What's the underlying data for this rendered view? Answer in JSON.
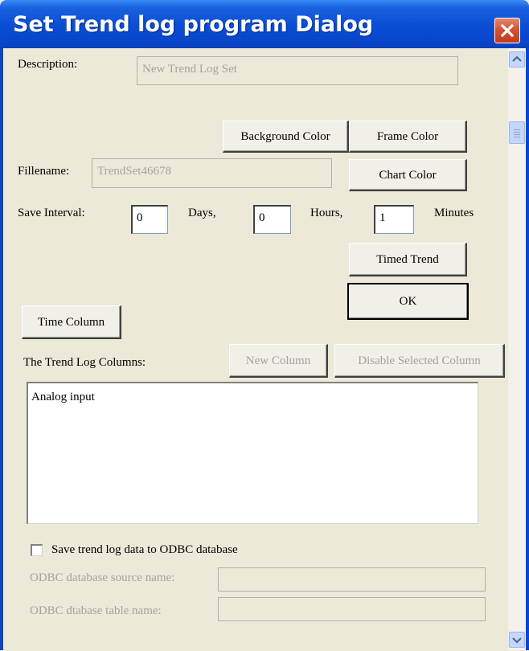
{
  "window": {
    "title": "Set Trend  log program Dialog"
  },
  "description": {
    "label": "Description:",
    "value": "New Trend Log Set"
  },
  "filename": {
    "label": "Fillename:",
    "value": "TrendSet46678"
  },
  "buttons": {
    "background_color": "Background Color",
    "frame_color": "Frame Color",
    "chart_color": "Chart Color",
    "timed_trend": "Timed Trend",
    "ok": "OK",
    "time_column": "Time Column",
    "new_column": "New Column",
    "disable_selected_column": "Disable Selected Column"
  },
  "save_interval": {
    "label": "Save Interval:",
    "days_value": "0",
    "days_label": "Days,",
    "hours_value": "0",
    "hours_label": "Hours,",
    "minutes_value": "1",
    "minutes_label": "Minutes"
  },
  "columns": {
    "label": "The Trend Log Columns:",
    "items": [
      "Analog input"
    ]
  },
  "odbc": {
    "checkbox_label": "Save trend log data to ODBC database",
    "checked": false,
    "source_label": "ODBC database source name:",
    "source_value": "",
    "table_label": "ODBC dtabase table name:",
    "table_value": ""
  },
  "colors": {
    "title_bar": "#0a4fd6",
    "dialog_bg": "#ece9d8",
    "close_button": "#d2502d"
  },
  "icons": {
    "close": "close-x-icon",
    "scroll_up": "chevron-up-icon",
    "scroll_down": "chevron-down-icon"
  }
}
